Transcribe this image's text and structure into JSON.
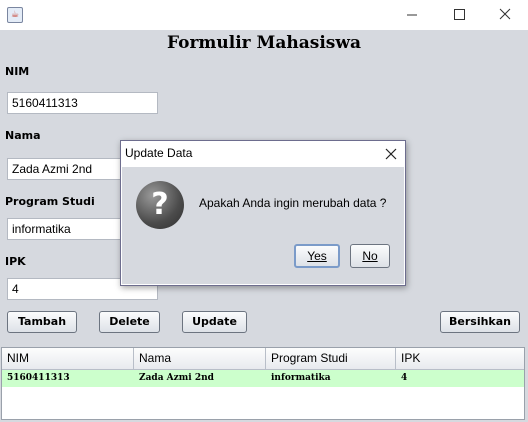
{
  "window": {
    "app_icon": "java-coffee-icon",
    "controls": [
      "minimize-icon",
      "maximize-icon",
      "close-icon"
    ]
  },
  "form": {
    "title": "Formulir Mahasiswa",
    "fields": {
      "nim": {
        "label": "NIM",
        "value": "5160411313"
      },
      "nama": {
        "label": "Nama",
        "value": "Zada Azmi 2nd"
      },
      "prodi": {
        "label": "Program Studi",
        "value": "informatika"
      },
      "ipk": {
        "label": "IPK",
        "value": "4"
      }
    },
    "buttons": {
      "tambah": "Tambah",
      "delete": "Delete",
      "update": "Update",
      "bersihkan": "Bersihkan"
    }
  },
  "table": {
    "columns": [
      "NIM",
      "Nama",
      "Program Studi",
      "IPK"
    ],
    "rows": [
      [
        "5160411313",
        "Zada Azmi 2nd",
        "informatika",
        "4"
      ]
    ],
    "selected_row_color": "#ccffcc"
  },
  "dialog": {
    "title": "Update Data",
    "message": "Apakah Anda ingin merubah data ?",
    "icon": "question-icon",
    "yes_label": "Yes",
    "no_label": "No"
  },
  "colors": {
    "panel_bg": "#d6d9df",
    "accent_focus": "#7b9bc9"
  }
}
